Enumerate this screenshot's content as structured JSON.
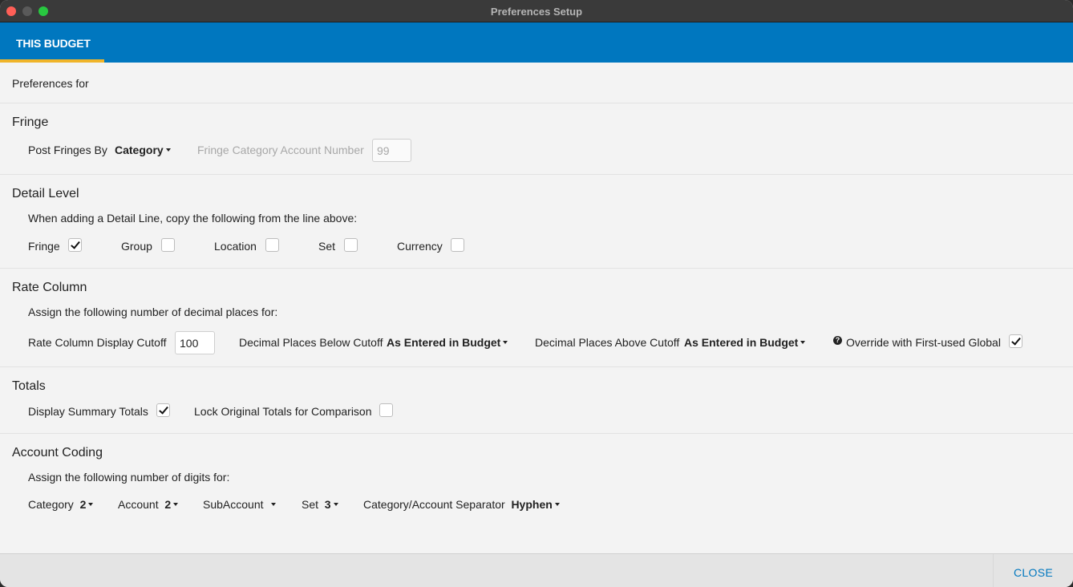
{
  "window": {
    "title": "Preferences Setup"
  },
  "tabs": [
    {
      "label": "THIS BUDGET",
      "active": true
    }
  ],
  "preferences_for_label": "Preferences for",
  "fringe": {
    "heading": "Fringe",
    "post_fringes_by_label": "Post Fringes By",
    "post_fringes_by_value": "Category",
    "account_number_label": "Fringe Category Account Number",
    "account_number_value": "99"
  },
  "detail_level": {
    "heading": "Detail Level",
    "description": "When adding a Detail Line, copy the following from the line above:",
    "options": [
      {
        "label": "Fringe",
        "checked": true
      },
      {
        "label": "Group",
        "checked": false
      },
      {
        "label": "Location",
        "checked": false
      },
      {
        "label": "Set",
        "checked": false
      },
      {
        "label": "Currency",
        "checked": false
      }
    ]
  },
  "rate_column": {
    "heading": "Rate Column",
    "description": "Assign the following number of decimal places for:",
    "cutoff_label": "Rate Column Display Cutoff",
    "cutoff_value": "100",
    "below_label": "Decimal Places Below Cutoff",
    "below_value": "As Entered in Budget",
    "above_label": "Decimal Places Above Cutoff",
    "above_value": "As Entered in Budget",
    "override_label": "Override with First-used Global",
    "override_checked": true
  },
  "totals": {
    "heading": "Totals",
    "display_summary_label": "Display Summary Totals",
    "display_summary_checked": true,
    "lock_original_label": "Lock Original Totals for Comparison",
    "lock_original_checked": false
  },
  "account_coding": {
    "heading": "Account Coding",
    "description": "Assign the following number of digits for:",
    "category_label": "Category",
    "category_value": "2",
    "account_label": "Account",
    "account_value": "2",
    "subaccount_label": "SubAccount",
    "subaccount_value": "",
    "set_label": "Set",
    "set_value": "3",
    "separator_label": "Category/Account Separator",
    "separator_value": "Hyphen"
  },
  "footer": {
    "close_label": "CLOSE"
  },
  "colors": {
    "accent": "#0077bf",
    "tab_indicator": "#f0b429",
    "titlebar": "#3a3a3a"
  }
}
